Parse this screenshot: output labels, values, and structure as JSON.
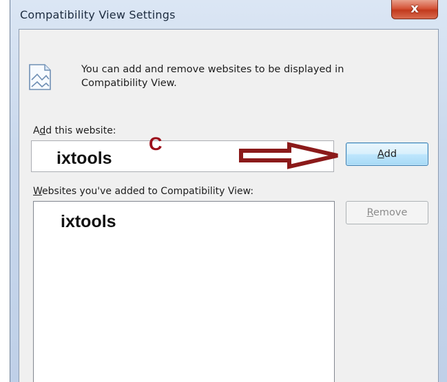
{
  "window": {
    "title": "Compatibility View Settings",
    "close_symbol": "x"
  },
  "info": {
    "icon": "compatibility-page-icon",
    "line1": "You can add and remove websites to be displayed in",
    "line2": "Compatibility View."
  },
  "add_section": {
    "label": "Add this website:",
    "input_value": "ixtools",
    "annotation_letter": "C",
    "add_button": "Add"
  },
  "list_section": {
    "label": "Websites you've added to Compatibility View:",
    "items": [
      "ixtools"
    ],
    "remove_button": "Remove"
  },
  "colors": {
    "annotation": "#9b0f1a",
    "arrow_fill": "#ffffff",
    "arrow_stroke": "#8b1a1a"
  }
}
